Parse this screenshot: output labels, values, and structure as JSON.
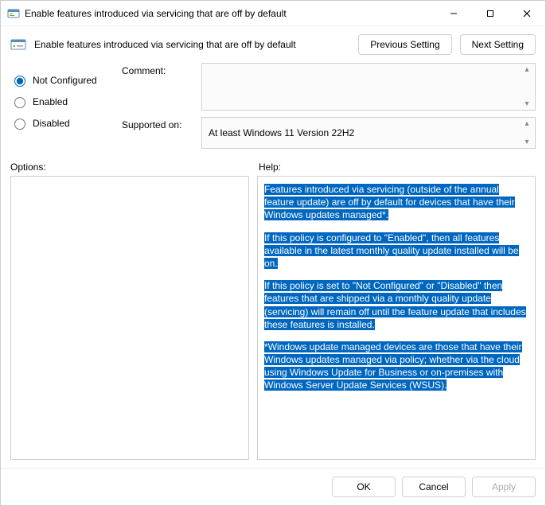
{
  "window": {
    "title": "Enable features introduced via servicing that are off by default"
  },
  "header": {
    "title": "Enable features introduced via servicing that are off by default",
    "previous": "Previous Setting",
    "next": "Next Setting"
  },
  "state": {
    "options": [
      {
        "value": "not_configured",
        "label": "Not Configured",
        "selected": true
      },
      {
        "value": "enabled",
        "label": "Enabled",
        "selected": false
      },
      {
        "value": "disabled",
        "label": "Disabled",
        "selected": false
      }
    ]
  },
  "form": {
    "comment_label": "Comment:",
    "comment_value": "",
    "supported_label": "Supported on:",
    "supported_value": "At least Windows 11 Version 22H2"
  },
  "sections": {
    "options_label": "Options:",
    "help_label": "Help:"
  },
  "help": {
    "p1": "Features introduced via servicing (outside of the annual feature update) are off by default for devices that have their Windows updates managed*.",
    "p2": "If this policy is configured to \"Enabled\", then all features available in the latest monthly quality update installed will be on.",
    "p3": "If this policy is set to \"Not Configured\" or \"Disabled\" then features that are shipped via a monthly quality update (servicing) will remain off until the feature update that includes these features is installed.",
    "p4": " *Windows update managed devices are those that have their Windows updates managed via policy; whether via the cloud using Windows Update for Business or on-premises with Windows Server Update Services (WSUS)."
  },
  "footer": {
    "ok": "OK",
    "cancel": "Cancel",
    "apply": "Apply"
  },
  "icons": {
    "app": "app-icon",
    "policy": "policy-icon"
  }
}
